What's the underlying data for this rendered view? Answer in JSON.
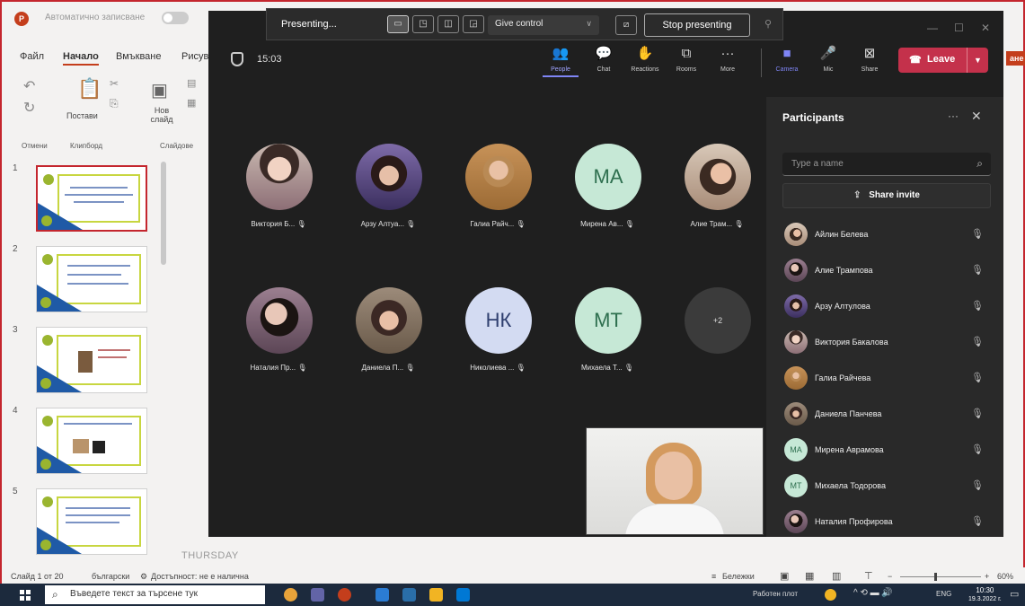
{
  "ppt": {
    "autosave_label": "Автоматично записване",
    "menu": [
      "Файл",
      "Начало",
      "Вмъкване",
      "Рисув"
    ],
    "ribbon": {
      "undo_label": "Отмени",
      "paste_label": "Постави",
      "clipboard_label": "Клипборд",
      "new_slide_label": "Нов слайд",
      "slides_label": "Слайдове"
    },
    "right_tab": "ане",
    "slide_numbers": [
      "1",
      "2",
      "3",
      "4",
      "5"
    ],
    "notes_placeholder": "THURSDAY",
    "status": {
      "slide_count": "Слайд 1 от 20",
      "language": "български",
      "accessibility": "Достъпност: не е налична",
      "notes": "Бележки",
      "zoom": "60%"
    }
  },
  "taskbar": {
    "search_placeholder": "Въведете текст за търсене тук",
    "weather": "Работен плот",
    "lang": "ENG",
    "time": "10:30",
    "date": "19.3.2022 г."
  },
  "presenting_bar": {
    "label": "Presenting...",
    "give_control": "Give control",
    "stop": "Stop presenting"
  },
  "teams": {
    "timer": "15:03",
    "toolbar": {
      "people": "People",
      "chat": "Chat",
      "reactions": "Reactions",
      "rooms": "Rooms",
      "more": "More",
      "camera": "Camera",
      "mic": "Mic",
      "share": "Share",
      "leave": "Leave"
    },
    "tiles": [
      {
        "name": "Виктория Б...",
        "initials": ""
      },
      {
        "name": "Арзу Алтуа...",
        "initials": ""
      },
      {
        "name": "Галиа Райч...",
        "initials": ""
      },
      {
        "name": "Мирена Ав...",
        "initials": "МА"
      },
      {
        "name": "Алие Трам...",
        "initials": ""
      },
      {
        "name": "Наталия Пр...",
        "initials": ""
      },
      {
        "name": "Даниела П...",
        "initials": ""
      },
      {
        "name": "Николиева ...",
        "initials": "НК"
      },
      {
        "name": "Михаела Т...",
        "initials": "МТ"
      },
      {
        "name": "",
        "initials": "+2"
      }
    ],
    "participants_panel": {
      "title": "Participants",
      "search_placeholder": "Type a name",
      "share_invite": "Share invite",
      "list": [
        {
          "name": "Айлин Белева",
          "initials": ""
        },
        {
          "name": "Алие Трампова",
          "initials": ""
        },
        {
          "name": "Арзу Алтулова",
          "initials": ""
        },
        {
          "name": "Виктория Бакалова",
          "initials": ""
        },
        {
          "name": "Галиа Райчева",
          "initials": ""
        },
        {
          "name": "Даниела Панчева",
          "initials": ""
        },
        {
          "name": "Мирена Аврамова",
          "initials": "МА"
        },
        {
          "name": "Михаела Тодорова",
          "initials": "МТ"
        },
        {
          "name": "Наталия Профирова",
          "initials": ""
        }
      ]
    }
  },
  "colors": {
    "teams_bg": "#1f1f1f",
    "panel_bg": "#292929",
    "leave_red": "#c4314b",
    "accent_purple": "#7f85f5",
    "ppt_red": "#c43e1c",
    "initials_mint": "#c6e8d6",
    "initials_lavender": "#d3dbf2"
  }
}
